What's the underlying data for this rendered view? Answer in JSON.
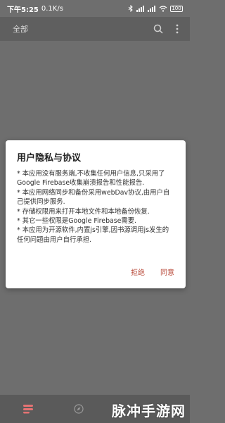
{
  "status_bar": {
    "time": "下午5:25",
    "net_speed": "0.1K/s",
    "battery": "100"
  },
  "toolbar": {
    "title": "全部",
    "search_icon": "search-icon",
    "more_icon": "more-vert-icon"
  },
  "dialog": {
    "title": "用户隐私与协议",
    "lines": [
      "* 本应用没有服务端,不收集任何用户信息,只采用了Google Firebase收集崩溃报告和性能报告.",
      "* 本应用网络同步和备份采用webDav协议,由用户自己提供同步服务.",
      "* 存储权限用来打开本地文件和本地备份恢复.",
      "* 其它一些权限是Google Firebase需要.",
      "* 本应用为开源软件,内置js引擎,因书源调用js发生的任何问题由用户自行承担."
    ],
    "reject_label": "拒绝",
    "agree_label": "同意"
  },
  "bottom_nav": {
    "items": [
      {
        "icon": "bookshelf-icon"
      },
      {
        "icon": "explore-icon"
      }
    ]
  },
  "watermark": "脉冲手游网",
  "colors": {
    "overlay": "#6e6e6e",
    "dialog_bg": "#ffffff",
    "accent": "#b84a3a",
    "nav_icon_active": "#e57373"
  }
}
